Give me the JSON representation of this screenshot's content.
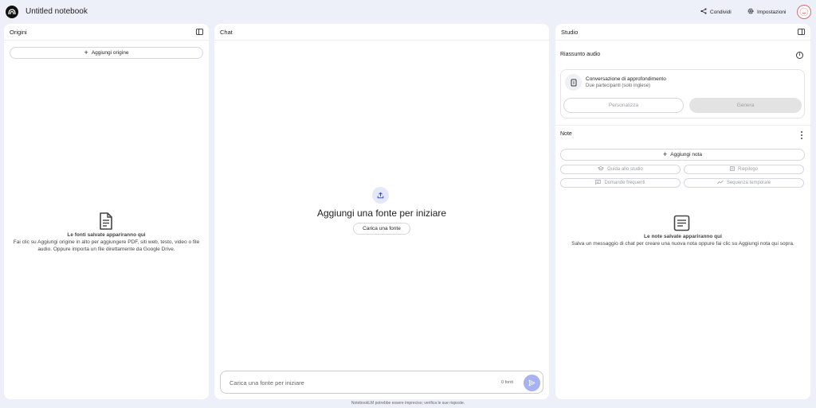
{
  "header": {
    "title": "Untitled notebook",
    "share_label": "Condividi",
    "settings_label": "Impostazioni"
  },
  "sources": {
    "title": "Origini",
    "add_label": "Aggiungi origine",
    "empty_title": "Le fonti salvate appariranno qui",
    "empty_desc": "Fai clic su Aggiungi origine in alto per aggiungere PDF, siti web, testo, video o file audio. Oppure importa un file direttamente da Google Drive."
  },
  "chat": {
    "title": "Chat",
    "heading": "Aggiungi una fonte per iniziare",
    "upload_label": "Carica una fonte",
    "input_placeholder": "Carica una fonte per iniziare",
    "source_count": "0 fonti",
    "disclaimer": "NotebookLM potrebbe essere impreciso; verifica le sue risposte."
  },
  "studio": {
    "title": "Studio",
    "audio_section": "Riassunto audio",
    "audio_card_title": "Conversazione di approfondimento",
    "audio_card_sub": "Due partecipanti (solo inglese)",
    "customize_label": "Personalizza",
    "generate_label": "Genera",
    "notes_section": "Note",
    "add_note_label": "Aggiungi nota",
    "study_guide_label": "Guida allo studio",
    "summary_label": "Riepilogo",
    "faq_label": "Domande frequenti",
    "timeline_label": "Sequenza temporale",
    "empty_title": "Le note salvate appariranno qui",
    "empty_desc": "Salva un messaggio di chat per creare una nuova nota oppure fai clic su Aggiungi nota qui sopra."
  },
  "icons": {
    "logo": "notebooklm-logo-icon",
    "share": "share-icon",
    "settings": "gear-icon",
    "panel_toggle": "panel-toggle-icon",
    "add": "plus-icon",
    "document": "document-icon",
    "upload": "upload-icon",
    "send": "send-icon",
    "info": "info-icon",
    "audio": "audio-file-icon",
    "more": "more-vert-icon"
  },
  "colors": {
    "background": "#eef0f9",
    "accent": "#a6b2f2",
    "upload_circle": "#e3e8fb"
  }
}
